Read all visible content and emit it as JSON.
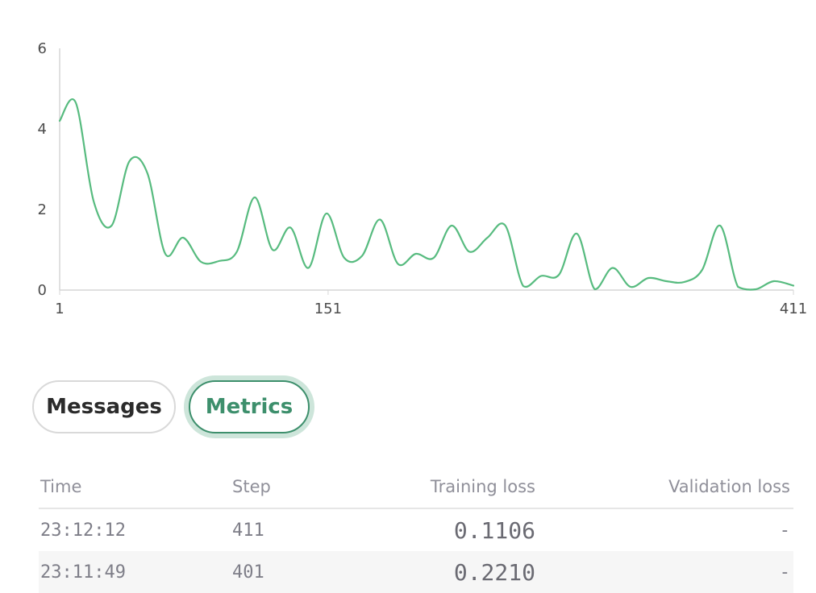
{
  "chart_data": {
    "type": "line",
    "color": "#57bb7f",
    "y_ticks": [
      "0",
      "2",
      "4",
      "6"
    ],
    "x_ticks": [
      {
        "value": 1,
        "label": "1"
      },
      {
        "value": 151,
        "label": "151"
      },
      {
        "value": 411,
        "label": "411"
      }
    ],
    "xlim": [
      1,
      411
    ],
    "ylim": [
      0,
      6
    ],
    "grid": false,
    "points": [
      [
        1,
        4.2
      ],
      [
        10,
        4.65
      ],
      [
        20,
        2.2
      ],
      [
        30,
        1.6
      ],
      [
        40,
        3.2
      ],
      [
        50,
        2.9
      ],
      [
        60,
        0.9
      ],
      [
        70,
        1.3
      ],
      [
        80,
        0.7
      ],
      [
        90,
        0.72
      ],
      [
        100,
        0.95
      ],
      [
        110,
        2.3
      ],
      [
        120,
        1.0
      ],
      [
        130,
        1.55
      ],
      [
        140,
        0.55
      ],
      [
        150,
        1.9
      ],
      [
        160,
        0.8
      ],
      [
        170,
        0.85
      ],
      [
        180,
        1.75
      ],
      [
        190,
        0.65
      ],
      [
        200,
        0.9
      ],
      [
        210,
        0.8
      ],
      [
        220,
        1.6
      ],
      [
        230,
        0.95
      ],
      [
        240,
        1.3
      ],
      [
        250,
        1.6
      ],
      [
        260,
        0.1
      ],
      [
        270,
        0.35
      ],
      [
        280,
        0.38
      ],
      [
        290,
        1.4
      ],
      [
        300,
        0.02
      ],
      [
        310,
        0.55
      ],
      [
        320,
        0.08
      ],
      [
        330,
        0.3
      ],
      [
        340,
        0.22
      ],
      [
        350,
        0.2
      ],
      [
        360,
        0.5
      ],
      [
        370,
        1.6
      ],
      [
        380,
        0.08
      ],
      [
        390,
        0.02
      ],
      [
        400,
        0.22
      ],
      [
        411,
        0.11
      ]
    ]
  },
  "tabs": {
    "messages": "Messages",
    "metrics": "Metrics",
    "active": "metrics"
  },
  "table": {
    "headers": {
      "time": "Time",
      "step": "Step",
      "training_loss": "Training loss",
      "validation_loss": "Validation loss"
    },
    "rows": [
      {
        "time": "23:12:12",
        "step": "411",
        "training_loss": "0.1106",
        "validation_loss": "-"
      },
      {
        "time": "23:11:49",
        "step": "401",
        "training_loss": "0.2210",
        "validation_loss": "-"
      }
    ]
  }
}
